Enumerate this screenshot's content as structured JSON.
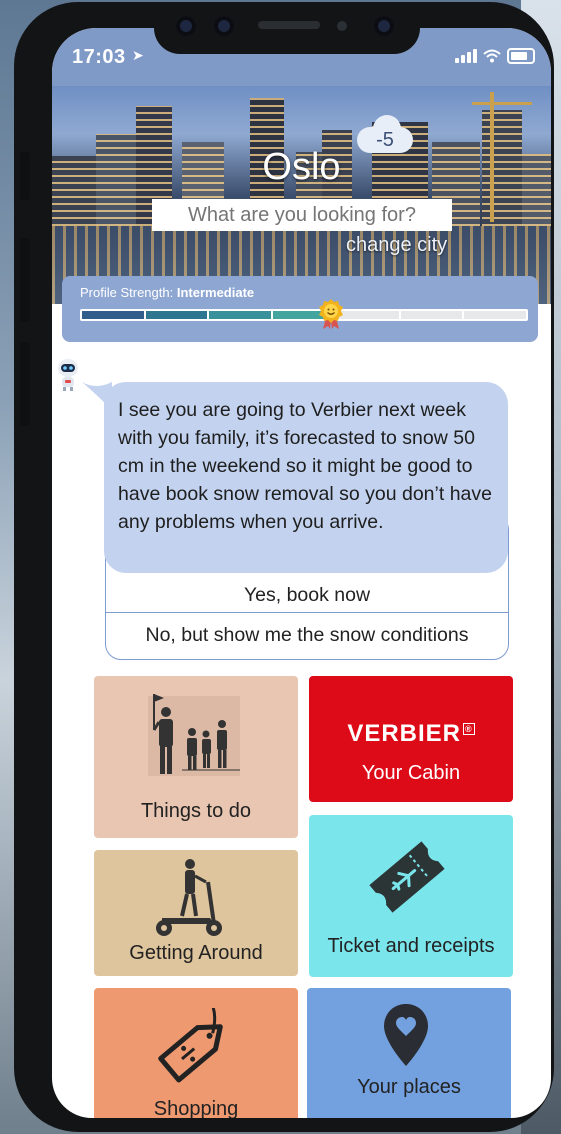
{
  "status_bar": {
    "time": "17:03"
  },
  "hero": {
    "city": "Oslo",
    "temperature": "-5",
    "search_placeholder": "What are you looking for?",
    "change_city": "change city"
  },
  "profile": {
    "label": "Profile Strength:",
    "level": "Intermediate",
    "progress": 0.5
  },
  "chat": {
    "message": "I see you are going to Verbier next week with you family, it’s forecasted to snow 50 cm in the weekend so it might be good to have book snow removal so you don’t have any problems when you arrive.",
    "reply_yes": "Yes, book now",
    "reply_no": "No, but show me the snow conditions"
  },
  "tiles": {
    "things": "Things to do",
    "verbier_brand": "VERBIER",
    "verbier_mark": "®",
    "verbier_sub": "Your Cabin",
    "ticket": "Ticket and receipts",
    "getting": "Getting Around",
    "shopping": "Shopping",
    "places": "Your places"
  },
  "colors": {
    "header_blue": "#7f9ac7",
    "bubble": "#c3d3ef",
    "verbier_red": "#dd0a18",
    "ticket_cyan": "#7ae6ec",
    "things_tan": "#e8c6b1",
    "getting_sand": "#dfc59d",
    "shopping_orange": "#ee9970",
    "places_blue": "#73a1df"
  },
  "icons": [
    "location-arrow-icon",
    "signal-icon",
    "wifi-icon",
    "battery-icon",
    "cloud-icon",
    "medal-icon",
    "robot-avatar-icon",
    "people-guide-icon",
    "ticket-plane-icon",
    "scooter-icon",
    "price-tag-icon",
    "map-pin-icon"
  ]
}
